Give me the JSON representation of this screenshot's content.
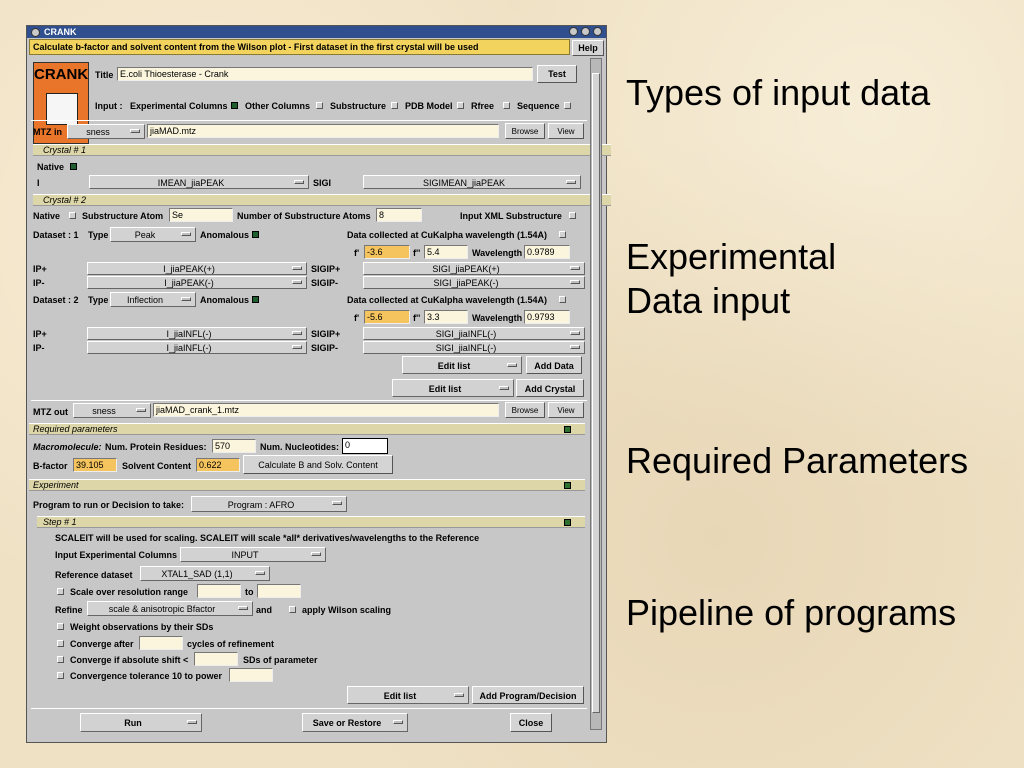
{
  "window": {
    "title": "CRANK",
    "message": "Calculate b-factor and solvent content from the Wilson plot - First dataset in the first crystal will be used",
    "help": "Help"
  },
  "logo": {
    "text": "CRANK"
  },
  "header": {
    "title_label": "Title",
    "title_value": "E.coli Thioesterase - Crank",
    "test": "Test",
    "input_label": "Input :",
    "input_opts": [
      "Experimental Columns",
      "Other Columns",
      "Substructure",
      "PDB Model",
      "Rfree",
      "Sequence"
    ]
  },
  "mtz_in": {
    "label": "MTZ in",
    "mode": "sness",
    "file": "jiaMAD.mtz",
    "browse": "Browse",
    "view": "View"
  },
  "crystal1": {
    "title": "Crystal # 1",
    "native": "Native",
    "i_label": "I",
    "i_val": "IMEAN_jiaPEAK",
    "sigi_label": "SIGI",
    "sigi_val": "SIGIMEAN_jiaPEAK"
  },
  "crystal2": {
    "title": "Crystal # 2",
    "native": "Native",
    "substructure_atom": "Substructure Atom",
    "atom_val": "Se",
    "num_atoms_label": "Number of Substructure Atoms",
    "num_atoms": "8",
    "input_xml": "Input XML Substructure",
    "ds1": {
      "label": "Dataset : 1",
      "type_label": "Type",
      "type": "Peak",
      "anomalous": "Anomalous",
      "collected": "Data collected at CuKalpha wavelength (1.54A)",
      "fp_label": "f'",
      "fp": "-3.6",
      "fpp_label": "f''",
      "fpp": "5.4",
      "wl_label": "Wavelength",
      "wl": "0.9789",
      "ip_label": "IP+",
      "ip": "I_jiaPEAK(+)",
      "sigip_label": "SIGIP+",
      "sigip": "SIGI_jiaPEAK(+)",
      "im_label": "IP-",
      "im": "I_jiaPEAK(-)",
      "sigim_label": "SIGIP-",
      "sigim": "SIGI_jiaPEAK(-)"
    },
    "ds2": {
      "label": "Dataset : 2",
      "type_label": "Type",
      "type": "Inflection",
      "anomalous": "Anomalous",
      "collected": "Data collected at CuKalpha wavelength (1.54A)",
      "fp_label": "f'",
      "fp": "-5.6",
      "fpp_label": "f''",
      "fpp": "3.3",
      "wl_label": "Wavelength",
      "wl": "0.9793",
      "ip_label": "IP+",
      "ip": "I_jiaINFL(-)",
      "sigip_label": "SIGIP+",
      "sigip": "SIGI_jiaINFL(-)",
      "im_label": "IP-",
      "im": "I_jiaINFL(-)",
      "sigim_label": "SIGIP-",
      "sigim": "SIGI_jiaINFL(-)"
    },
    "edit_list": "Edit list",
    "add_data": "Add Data"
  },
  "crystal_edit": {
    "edit_list": "Edit list",
    "add_crystal": "Add Crystal"
  },
  "mtz_out": {
    "label": "MTZ out",
    "mode": "sness",
    "file": "jiaMAD_crank_1.mtz",
    "browse": "Browse",
    "view": "View"
  },
  "required": {
    "title": "Required parameters",
    "macro": "Macromolecule:",
    "residues_label": "Num. Protein Residues:",
    "residues": "570",
    "nucleotides_label": "Num. Nucleotides:",
    "nucleotides": "0",
    "bfactor_label": "B-factor",
    "bfactor": "39.105",
    "solvent_label": "Solvent Content",
    "solvent": "0.622",
    "calc": "Calculate B and Solv. Content"
  },
  "experiment": {
    "title": "Experiment",
    "program_label": "Program to run or Decision to take:",
    "program": "Program : AFRO"
  },
  "step1": {
    "title": "Step # 1",
    "note": "SCALEIT will be used for scaling.  SCALEIT will scale *all* derivatives/wavelengths to the Reference",
    "input_cols_label": "Input Experimental Columns",
    "input_cols": "INPUT",
    "ref_label": "Reference dataset",
    "ref": "XTAL1_SAD (1,1)",
    "scale_range": "Scale over resolution range",
    "to": "to",
    "refine_label": "Refine",
    "refine": "scale & anisotropic Bfactor",
    "and": "and",
    "wilson": "apply Wilson scaling",
    "weight": "Weight observations by their SDs",
    "converge_after": "Converge after",
    "cycles": "cycles of refinement",
    "converge_abs": "Converge if absolute shift <",
    "sds": "SDs of parameter",
    "converge_tol": "Convergence tolerance 10 to power",
    "edit_list": "Edit list",
    "add_program": "Add Program/Decision"
  },
  "footer": {
    "run": "Run",
    "save": "Save or Restore",
    "close": "Close"
  },
  "slide": {
    "t1": "Types of input data",
    "t2a": "Experimental",
    "t2b": "Data input",
    "t3": "Required Parameters",
    "t4": "Pipeline of programs"
  }
}
